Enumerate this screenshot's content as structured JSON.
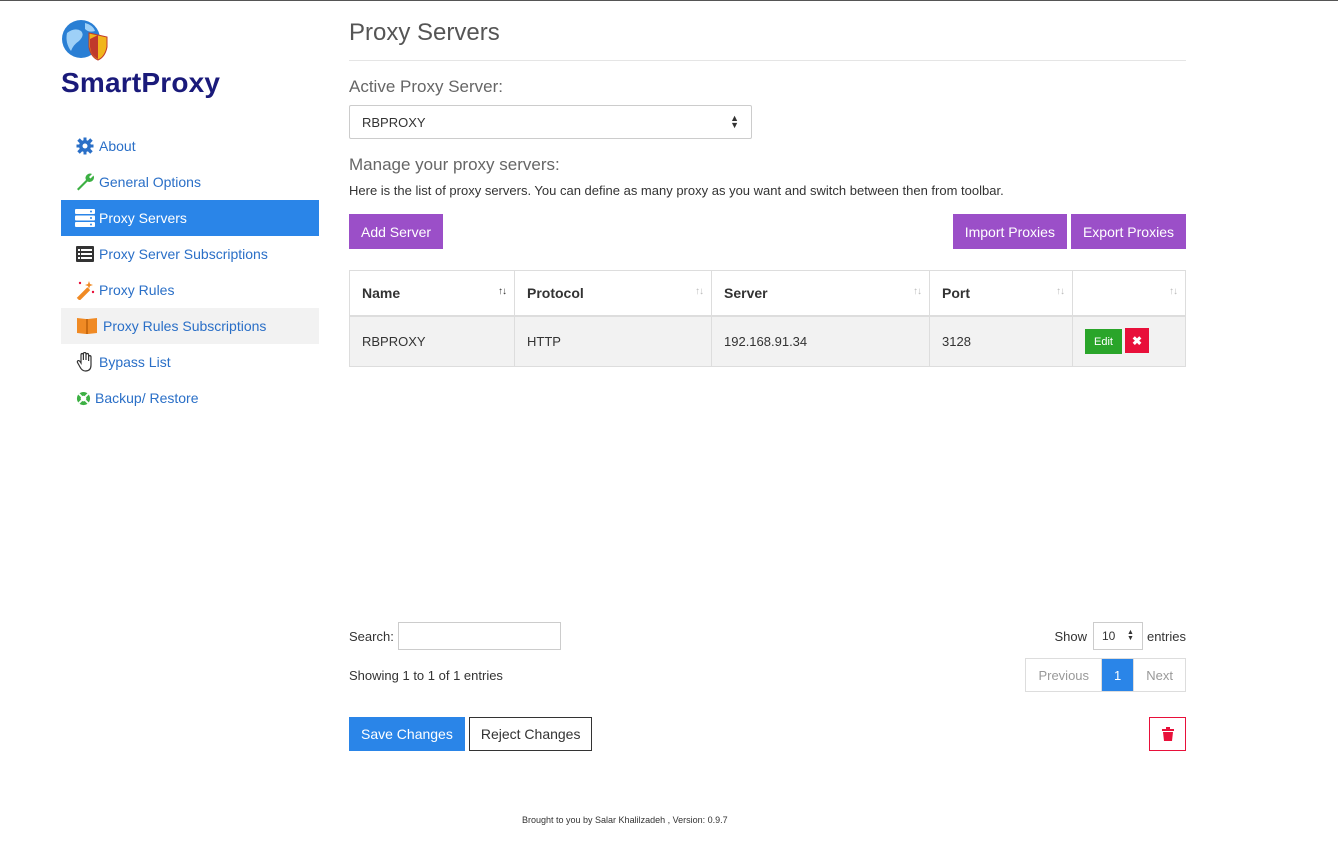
{
  "brand": "SmartProxy",
  "sidebar": {
    "items": [
      {
        "label": "About",
        "icon": "gear-icon"
      },
      {
        "label": "General Options",
        "icon": "wrench-icon"
      },
      {
        "label": "Proxy Servers",
        "icon": "server-icon"
      },
      {
        "label": "Proxy Server Subscriptions",
        "icon": "list-icon"
      },
      {
        "label": "Proxy Rules",
        "icon": "magic-wand-icon"
      },
      {
        "label": "Proxy Rules Subscriptions",
        "icon": "book-icon"
      },
      {
        "label": "Bypass List",
        "icon": "hand-icon"
      },
      {
        "label": "Backup/ Restore",
        "icon": "life-ring-icon"
      }
    ]
  },
  "main": {
    "title": "Proxy Servers",
    "active_label": "Active Proxy Server:",
    "active_value": "RBPROXY",
    "manage_label": "Manage your proxy servers:",
    "description": "Here is the list of proxy servers. You can define as many proxy as you want and switch between then from toolbar.",
    "add_server": "Add Server",
    "import_proxies": "Import Proxies",
    "export_proxies": "Export Proxies"
  },
  "table": {
    "columns": [
      "Name",
      "Protocol",
      "Server",
      "Port",
      ""
    ],
    "rows": [
      {
        "name": "RBPROXY",
        "protocol": "HTTP",
        "server": "192.168.91.34",
        "port": "3128"
      }
    ],
    "edit_label": "Edit",
    "delete_label": "✖"
  },
  "datatable": {
    "search_label": "Search:",
    "show_label": "Show",
    "page_length": "10",
    "entries_label": "entries",
    "info": "Showing 1 to 1 of 1 entries",
    "previous": "Previous",
    "current_page": "1",
    "next": "Next"
  },
  "actions": {
    "save": "Save Changes",
    "reject": "Reject Changes"
  },
  "footer": "Brought to you by Salar Khalilzadeh , Version: 0.9.7",
  "colors": {
    "primary": "#2a85e8",
    "purple": "#9b4fc8",
    "danger": "#e8103a",
    "success": "#2aa52a",
    "brand": "#1a1a7a"
  }
}
